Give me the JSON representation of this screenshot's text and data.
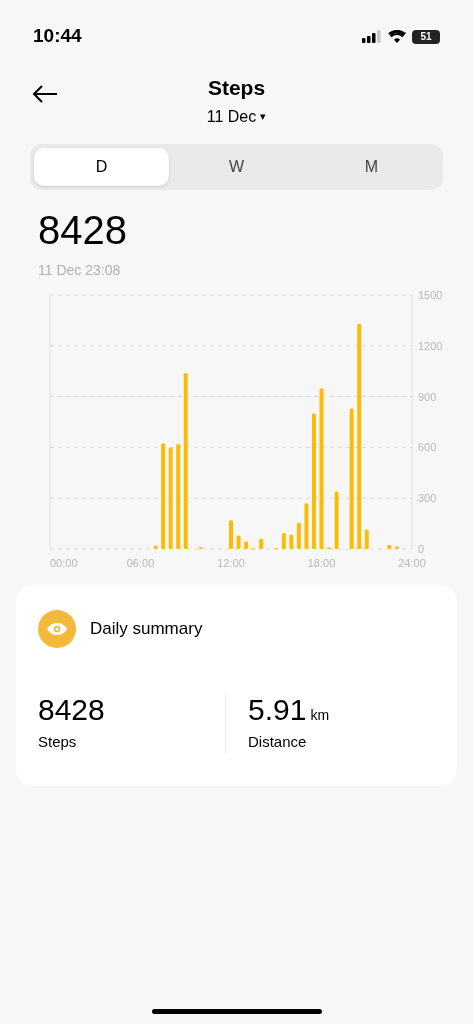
{
  "status_bar": {
    "time": "10:44",
    "battery": "51"
  },
  "header": {
    "title": "Steps",
    "date": "11 Dec",
    "date_caret": "▾"
  },
  "tabs": [
    {
      "label": "D",
      "selected": true
    },
    {
      "label": "W",
      "selected": false
    },
    {
      "label": "M",
      "selected": false
    }
  ],
  "total": {
    "value": "8428",
    "timestamp": "11 Dec 23:08"
  },
  "chart_data": {
    "type": "bar",
    "grid": true,
    "xlim": [
      0,
      24
    ],
    "ylim": [
      0,
      1500
    ],
    "xticks": [
      {
        "value": 0,
        "label": "00:00"
      },
      {
        "value": 6,
        "label": "06:00"
      },
      {
        "value": 12,
        "label": "12:00"
      },
      {
        "value": 18,
        "label": "18:00"
      },
      {
        "value": 24,
        "label": "24:00"
      }
    ],
    "yticks": [
      0,
      300,
      600,
      900,
      1200,
      1500
    ],
    "x": [
      7,
      7.5,
      8,
      8.5,
      9,
      10,
      12,
      12.5,
      13,
      13.5,
      14,
      15,
      15.5,
      16,
      16.5,
      17,
      17.5,
      18,
      18.5,
      19,
      20,
      20.5,
      21,
      22.5,
      23
    ],
    "series": [
      {
        "color": "#fbbc05",
        "values": [
          20,
          625,
          600,
          620,
          1040,
          10,
          170,
          80,
          45,
          5,
          60,
          5,
          95,
          85,
          155,
          270,
          800,
          950,
          10,
          340,
          830,
          1330,
          115,
          25,
          15
        ]
      }
    ]
  },
  "summary": {
    "title": "Daily summary",
    "metrics": [
      {
        "value": "8428",
        "label": "Steps"
      },
      {
        "value": "5.91",
        "unit": "km",
        "label": "Distance"
      }
    ]
  }
}
